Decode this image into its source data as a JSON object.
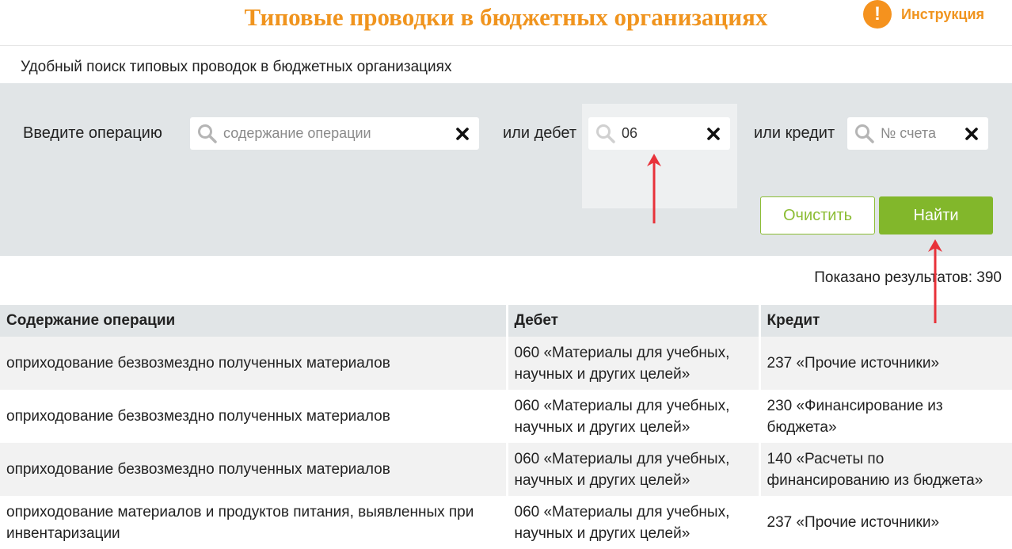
{
  "header": {
    "title": "Типовые проводки в бюджетных организациях",
    "instruction_icon_glyph": "!",
    "instruction_label": "Инструкция",
    "accent_color": "#f0941e"
  },
  "subtitle": "Удобный поиск типовых проводок в бюджетных организациях",
  "search": {
    "operation_label": "Введите операцию",
    "operation_placeholder": "содержание операции",
    "debit_label": "или дебет",
    "debit_value": "06",
    "credit_label": "или кредит",
    "credit_placeholder": "№ счета",
    "clear_button": "Очистить",
    "find_button": "Найти",
    "button_color": "#82b72b"
  },
  "results": {
    "count_text": "Показано результатов: 390"
  },
  "table": {
    "columns": [
      "Содержание операции",
      "Дебет",
      "Кредит"
    ],
    "rows": [
      [
        "оприходование безвозмездно полученных материалов",
        "060 «Материалы для учебных, научных и других целей»",
        "237 «Прочие источники»"
      ],
      [
        "оприходование безвозмездно полученных материалов",
        "060 «Материалы для учебных, научных и других целей»",
        "230 «Финансирование из бюджета»"
      ],
      [
        "оприходование безвозмездно полученных материалов",
        "060 «Материалы для учебных, научных и других целей»",
        "140 «Расчеты по финансированию из бюджета»"
      ],
      [
        "оприходование материалов и продуктов питания, выявленных при инвентаризации",
        "060 «Материалы для учебных, научных и других целей»",
        "237 «Прочие источники»"
      ]
    ]
  },
  "annotations": {
    "arrow_color": "#e8323a"
  }
}
